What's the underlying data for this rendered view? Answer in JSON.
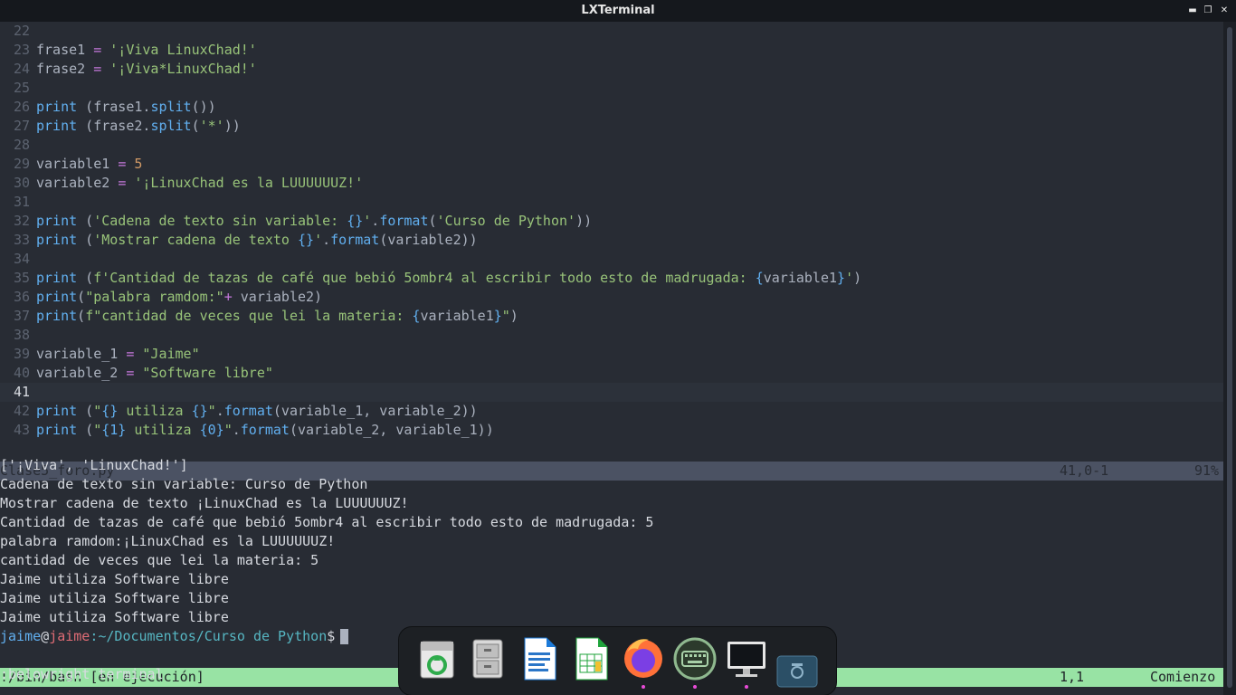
{
  "window": {
    "title": "LXTerminal",
    "buttons": [
      "minimize",
      "maximize",
      "close"
    ]
  },
  "editor": {
    "lines": [
      {
        "n": "22",
        "parts": []
      },
      {
        "n": "23",
        "parts": [
          {
            "t": "frase1 "
          },
          {
            "t": "=",
            "c": "o"
          },
          {
            "t": " "
          },
          {
            "t": "'¡Viva LinuxChad!'",
            "c": "s"
          }
        ]
      },
      {
        "n": "24",
        "parts": [
          {
            "t": "frase2 "
          },
          {
            "t": "=",
            "c": "o"
          },
          {
            "t": " "
          },
          {
            "t": "'¡Viva*LinuxChad!'",
            "c": "s"
          }
        ]
      },
      {
        "n": "25",
        "parts": []
      },
      {
        "n": "26",
        "parts": [
          {
            "t": "print",
            "c": "k"
          },
          {
            "t": " (frase1."
          },
          {
            "t": "split",
            "c": "f"
          },
          {
            "t": "())"
          }
        ]
      },
      {
        "n": "27",
        "parts": [
          {
            "t": "print",
            "c": "k"
          },
          {
            "t": " (frase2."
          },
          {
            "t": "split",
            "c": "f"
          },
          {
            "t": "("
          },
          {
            "t": "'*'",
            "c": "s"
          },
          {
            "t": "))"
          }
        ]
      },
      {
        "n": "28",
        "parts": []
      },
      {
        "n": "29",
        "parts": [
          {
            "t": "variable1 "
          },
          {
            "t": "=",
            "c": "o"
          },
          {
            "t": " "
          },
          {
            "t": "5",
            "c": "n"
          }
        ]
      },
      {
        "n": "30",
        "parts": [
          {
            "t": "variable2 "
          },
          {
            "t": "=",
            "c": "o"
          },
          {
            "t": " "
          },
          {
            "t": "'¡LinuxChad es la LUUUUUUZ!'",
            "c": "s"
          }
        ]
      },
      {
        "n": "31",
        "parts": []
      },
      {
        "n": "32",
        "parts": [
          {
            "t": "print",
            "c": "k"
          },
          {
            "t": " ("
          },
          {
            "t": "'Cadena de texto sin variable: ",
            "c": "s"
          },
          {
            "t": "{}",
            "c": "f"
          },
          {
            "t": "'",
            "c": "s"
          },
          {
            "t": "."
          },
          {
            "t": "format",
            "c": "f"
          },
          {
            "t": "("
          },
          {
            "t": "'Curso de Python'",
            "c": "s"
          },
          {
            "t": "))"
          }
        ]
      },
      {
        "n": "33",
        "parts": [
          {
            "t": "print",
            "c": "k"
          },
          {
            "t": " ("
          },
          {
            "t": "'Mostrar cadena de texto ",
            "c": "s"
          },
          {
            "t": "{}",
            "c": "f"
          },
          {
            "t": "'",
            "c": "s"
          },
          {
            "t": "."
          },
          {
            "t": "format",
            "c": "f"
          },
          {
            "t": "(variable2))"
          }
        ]
      },
      {
        "n": "34",
        "parts": []
      },
      {
        "n": "35",
        "parts": [
          {
            "t": "print",
            "c": "k"
          },
          {
            "t": " ("
          },
          {
            "t": "f'Cantidad de tazas de café que bebió 5ombr4 al escribir todo esto de madrugada: ",
            "c": "s"
          },
          {
            "t": "{",
            "c": "f"
          },
          {
            "t": "variable1"
          },
          {
            "t": "}",
            "c": "f"
          },
          {
            "t": "'",
            "c": "s"
          },
          {
            "t": ")"
          }
        ]
      },
      {
        "n": "36",
        "parts": [
          {
            "t": "print",
            "c": "k"
          },
          {
            "t": "("
          },
          {
            "t": "\"palabra ramdom:\"",
            "c": "s"
          },
          {
            "t": "+",
            "c": "o"
          },
          {
            "t": " variable2)"
          }
        ]
      },
      {
        "n": "37",
        "parts": [
          {
            "t": "print",
            "c": "k"
          },
          {
            "t": "("
          },
          {
            "t": "f\"cantidad de veces que lei la materia: ",
            "c": "s"
          },
          {
            "t": "{",
            "c": "f"
          },
          {
            "t": "variable1"
          },
          {
            "t": "}",
            "c": "f"
          },
          {
            "t": "\"",
            "c": "s"
          },
          {
            "t": ")"
          }
        ]
      },
      {
        "n": "38",
        "parts": []
      },
      {
        "n": "39",
        "parts": [
          {
            "t": "variable_1 "
          },
          {
            "t": "=",
            "c": "o"
          },
          {
            "t": " "
          },
          {
            "t": "\"Jaime\"",
            "c": "s"
          }
        ]
      },
      {
        "n": "40",
        "parts": [
          {
            "t": "variable_2 "
          },
          {
            "t": "=",
            "c": "o"
          },
          {
            "t": " "
          },
          {
            "t": "\"Software libre\"",
            "c": "s"
          }
        ]
      },
      {
        "n": "41",
        "parts": [],
        "current": true
      },
      {
        "n": "42",
        "parts": [
          {
            "t": "print",
            "c": "k"
          },
          {
            "t": " ("
          },
          {
            "t": "\"",
            "c": "s"
          },
          {
            "t": "{}",
            "c": "f"
          },
          {
            "t": " utiliza ",
            "c": "s"
          },
          {
            "t": "{}",
            "c": "f"
          },
          {
            "t": "\"",
            "c": "s"
          },
          {
            "t": "."
          },
          {
            "t": "format",
            "c": "f"
          },
          {
            "t": "(variable_1, variable_2))"
          }
        ]
      },
      {
        "n": "43",
        "parts": [
          {
            "t": "print",
            "c": "k"
          },
          {
            "t": " ("
          },
          {
            "t": "\"",
            "c": "s"
          },
          {
            "t": "{1}",
            "c": "f"
          },
          {
            "t": " utiliza ",
            "c": "s"
          },
          {
            "t": "{0}",
            "c": "f"
          },
          {
            "t": "\"",
            "c": "s"
          },
          {
            "t": "."
          },
          {
            "t": "format",
            "c": "f"
          },
          {
            "t": "(variable_2, variable_1))"
          }
        ]
      }
    ],
    "status": {
      "filename": "Clase5_foro.py",
      "position": "41,0-1",
      "percent": "91%"
    }
  },
  "terminal": {
    "output": [
      "['¡Viva', 'LinuxChad!']",
      "Cadena de texto sin variable: Curso de Python",
      "Mostrar cadena de texto ¡LinuxChad es la LUUUUUUZ!",
      "Cantidad de tazas de café que bebió 5ombr4 al escribir todo esto de madrugada: 5",
      "palabra ramdom:¡LinuxChad es la LUUUUUUZ!",
      "cantidad de veces que lei la materia: 5",
      "Jaime utiliza Software libre",
      "Jaime utiliza Software libre",
      "Jaime utiliza Software libre"
    ],
    "prompt": {
      "user": "jaime",
      "at": "@",
      "host": "jaime",
      "path": ":~/Documentos/Curso de Python",
      "symbol": "$"
    },
    "status": {
      "left": "!/bin/bash [en ejecución]",
      "position": "1,1",
      "right": "Comienzo"
    },
    "cmdline": ":belowright terminal"
  },
  "dock": {
    "items": [
      {
        "name": "trash-icon",
        "running": false
      },
      {
        "name": "file-cabinet-icon",
        "running": false
      },
      {
        "name": "writer-document-icon",
        "running": false
      },
      {
        "name": "calc-spreadsheet-icon",
        "running": false
      },
      {
        "name": "firefox-icon",
        "running": true
      },
      {
        "name": "keyboard-icon",
        "running": true
      },
      {
        "name": "monitor-icon",
        "running": true
      },
      {
        "name": "screenshot-icon",
        "running": false
      }
    ]
  },
  "colors": {
    "background": "#282c34",
    "keyword": "#61afef",
    "string": "#98c379",
    "operator": "#c678dd",
    "number": "#d19a66",
    "status_active": "#98e3a4",
    "status_inactive": "#4b5263"
  }
}
